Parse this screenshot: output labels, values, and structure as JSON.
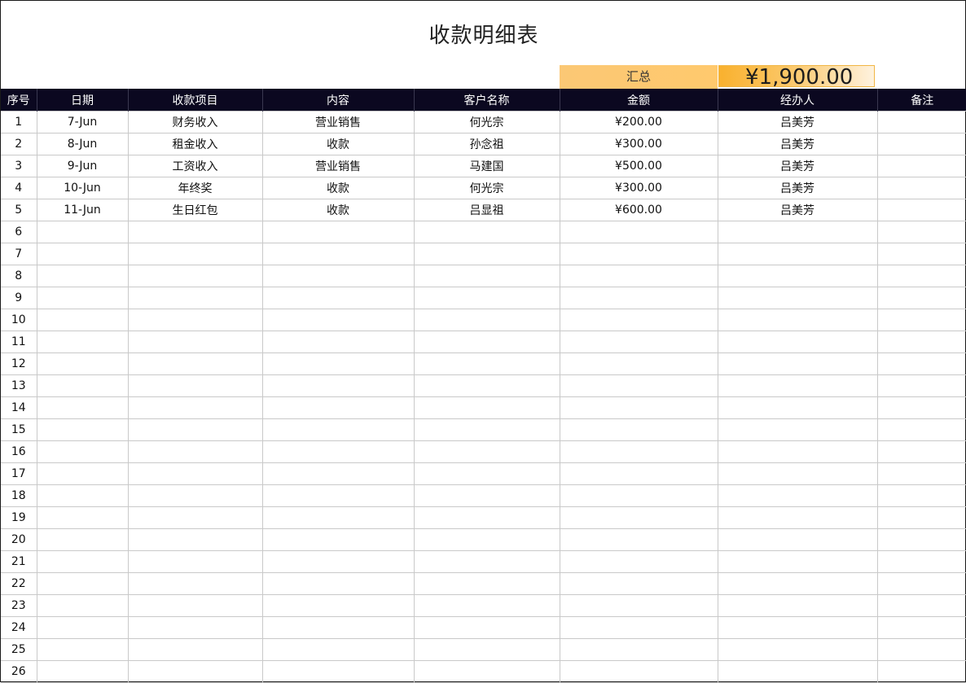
{
  "sheet": {
    "title": "收款明细表",
    "summary_label": "汇总",
    "summary_value": "¥1,900.00"
  },
  "columns": [
    "序号",
    "日期",
    "收款项目",
    "内容",
    "客户名称",
    "金额",
    "经办人",
    "备注"
  ],
  "rows": [
    [
      "1",
      "7-Jun",
      "财务收入",
      "营业销售",
      "何光宗",
      "¥200.00",
      "吕美芳",
      ""
    ],
    [
      "2",
      "8-Jun",
      "租金收入",
      "收款",
      "孙念祖",
      "¥300.00",
      "吕美芳",
      ""
    ],
    [
      "3",
      "9-Jun",
      "工资收入",
      "营业销售",
      "马建国",
      "¥500.00",
      "吕美芳",
      ""
    ],
    [
      "4",
      "10-Jun",
      "年终奖",
      "收款",
      "何光宗",
      "¥300.00",
      "吕美芳",
      ""
    ],
    [
      "5",
      "11-Jun",
      "生日红包",
      "收款",
      "吕显祖",
      "¥600.00",
      "吕美芳",
      ""
    ],
    [
      "6",
      "",
      "",
      "",
      "",
      "",
      "",
      ""
    ],
    [
      "7",
      "",
      "",
      "",
      "",
      "",
      "",
      ""
    ],
    [
      "8",
      "",
      "",
      "",
      "",
      "",
      "",
      ""
    ],
    [
      "9",
      "",
      "",
      "",
      "",
      "",
      "",
      ""
    ],
    [
      "10",
      "",
      "",
      "",
      "",
      "",
      "",
      ""
    ],
    [
      "11",
      "",
      "",
      "",
      "",
      "",
      "",
      ""
    ],
    [
      "12",
      "",
      "",
      "",
      "",
      "",
      "",
      ""
    ],
    [
      "13",
      "",
      "",
      "",
      "",
      "",
      "",
      ""
    ],
    [
      "14",
      "",
      "",
      "",
      "",
      "",
      "",
      ""
    ],
    [
      "15",
      "",
      "",
      "",
      "",
      "",
      "",
      ""
    ],
    [
      "16",
      "",
      "",
      "",
      "",
      "",
      "",
      ""
    ],
    [
      "17",
      "",
      "",
      "",
      "",
      "",
      "",
      ""
    ],
    [
      "18",
      "",
      "",
      "",
      "",
      "",
      "",
      ""
    ],
    [
      "19",
      "",
      "",
      "",
      "",
      "",
      "",
      ""
    ],
    [
      "20",
      "",
      "",
      "",
      "",
      "",
      "",
      ""
    ],
    [
      "21",
      "",
      "",
      "",
      "",
      "",
      "",
      ""
    ],
    [
      "22",
      "",
      "",
      "",
      "",
      "",
      "",
      ""
    ],
    [
      "23",
      "",
      "",
      "",
      "",
      "",
      "",
      ""
    ],
    [
      "24",
      "",
      "",
      "",
      "",
      "",
      "",
      ""
    ],
    [
      "25",
      "",
      "",
      "",
      "",
      "",
      "",
      ""
    ],
    [
      "26",
      "",
      "",
      "",
      "",
      "",
      "",
      ""
    ]
  ]
}
